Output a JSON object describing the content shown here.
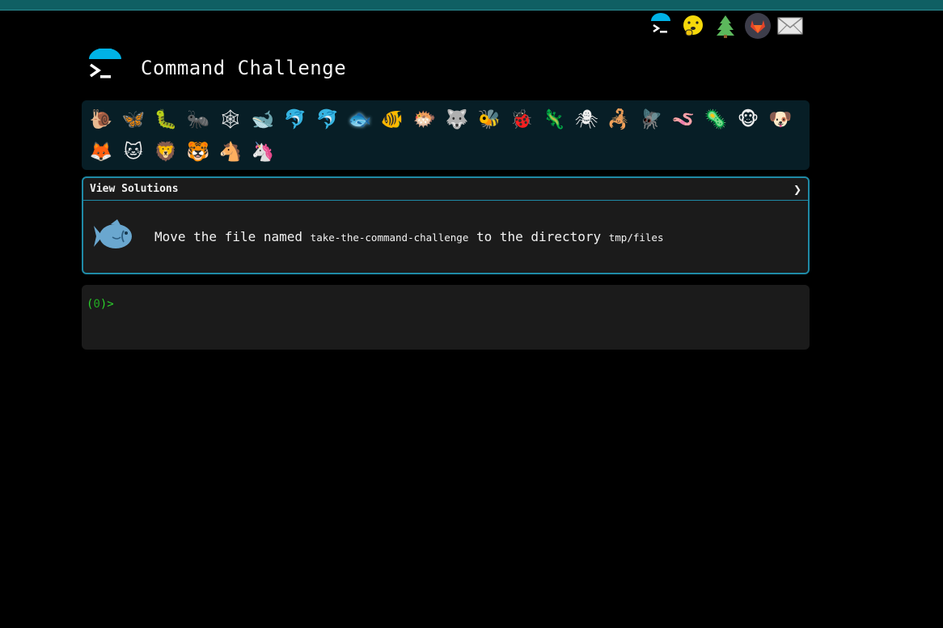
{
  "header": {
    "title": "Command Challenge",
    "icons": [
      "terminal-icon",
      "hushed-face-icon",
      "tree-icon",
      "gitlab-icon",
      "mail-icon"
    ]
  },
  "animals": [
    {
      "name": "snail",
      "glyph": "🐌"
    },
    {
      "name": "butterfly",
      "glyph": "🦋"
    },
    {
      "name": "caterpillar",
      "glyph": "🐛"
    },
    {
      "name": "ant",
      "glyph": "🐜"
    },
    {
      "name": "spider-web",
      "glyph": "🕸"
    },
    {
      "name": "whale",
      "glyph": "🐋"
    },
    {
      "name": "dolphin",
      "glyph": "🐬"
    },
    {
      "name": "shark",
      "glyph": "🐬"
    },
    {
      "name": "fish",
      "glyph": "🐟",
      "active": true
    },
    {
      "name": "tropical-fish",
      "glyph": "🐠"
    },
    {
      "name": "blowfish",
      "glyph": "🐡"
    },
    {
      "name": "wolf",
      "glyph": "🐺"
    },
    {
      "name": "bee",
      "glyph": "🐝"
    },
    {
      "name": "ladybug",
      "glyph": "🐞"
    },
    {
      "name": "lizard",
      "glyph": "🦎"
    },
    {
      "name": "spider",
      "glyph": "🕷"
    },
    {
      "name": "scorpion",
      "glyph": "🦂"
    },
    {
      "name": "fly",
      "glyph": "🪰"
    },
    {
      "name": "worm",
      "glyph": "🪱"
    },
    {
      "name": "microbe",
      "glyph": "🦠"
    },
    {
      "name": "chimpanzee",
      "glyph": "🐵"
    },
    {
      "name": "dog",
      "glyph": "🐶"
    },
    {
      "name": "fox",
      "glyph": "🦊"
    },
    {
      "name": "cat",
      "glyph": "🐱"
    },
    {
      "name": "lion",
      "glyph": "🦁"
    },
    {
      "name": "tiger",
      "glyph": "🐯"
    },
    {
      "name": "horse",
      "glyph": "🐴"
    },
    {
      "name": "unicorn",
      "glyph": "🦄"
    }
  ],
  "panel": {
    "header": "View Solutions",
    "chevron": "❯",
    "challenge_prefix": "Move the file named",
    "challenge_file": "take-the-command-challenge",
    "challenge_middle": "to the directory",
    "challenge_dir": "tmp/files"
  },
  "terminal": {
    "prompt_open": "(",
    "prompt_count": "0",
    "prompt_close": ")>"
  },
  "colors": {
    "accent": "#1f8aa6",
    "topbar": "#0f5f63",
    "prompt_green": "#2bd12b"
  }
}
